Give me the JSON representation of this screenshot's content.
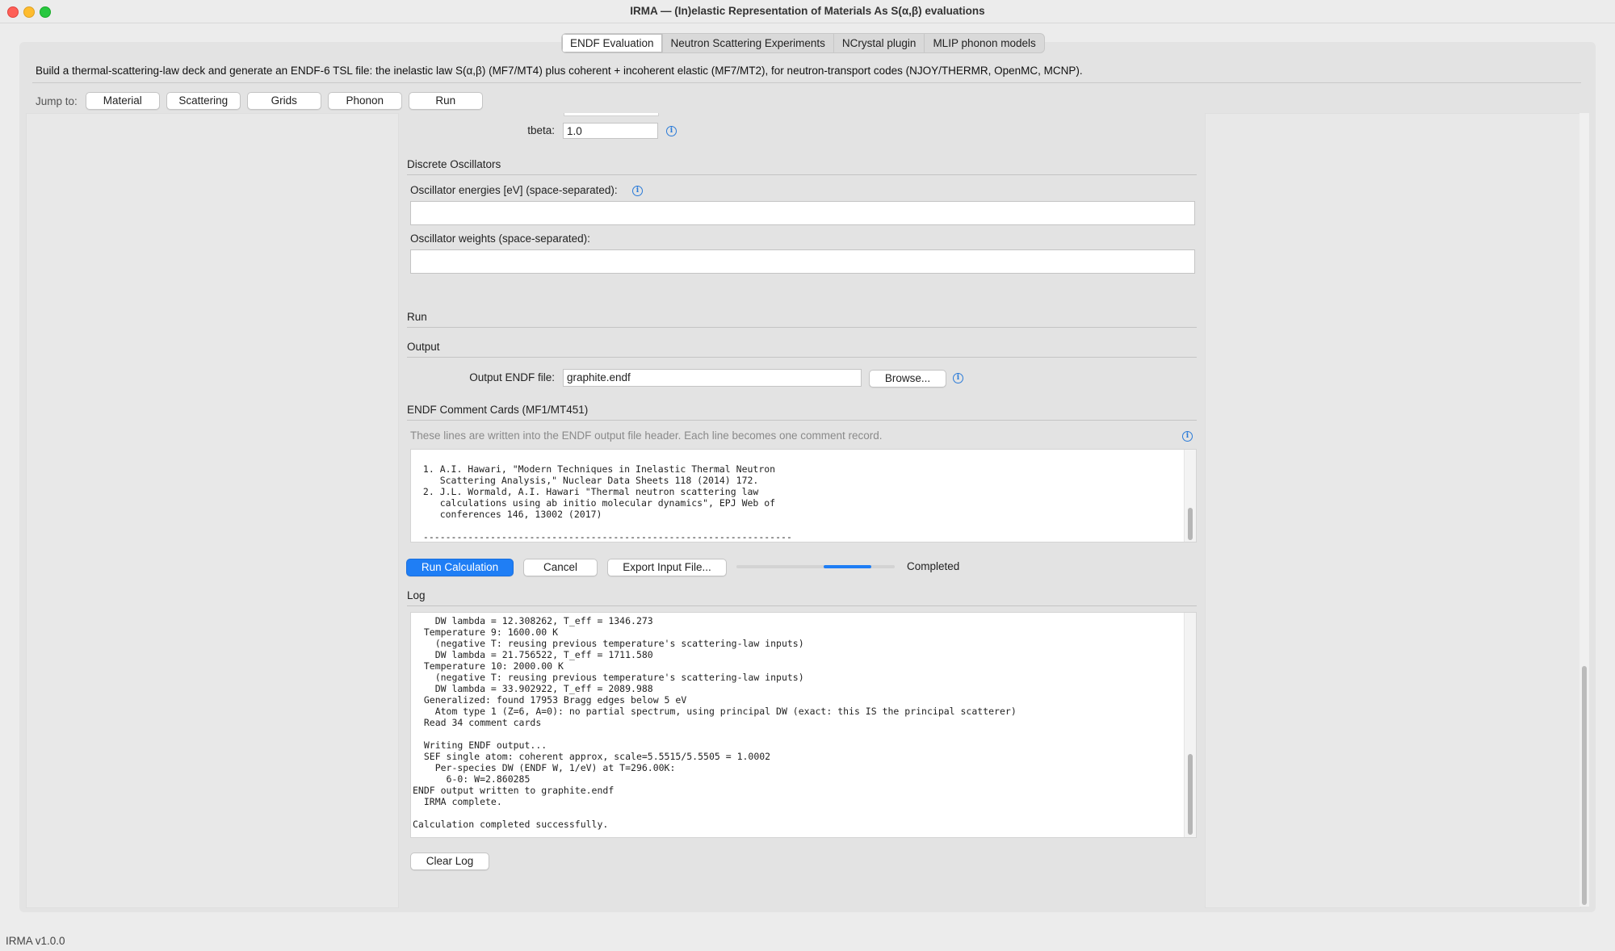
{
  "window": {
    "title": "IRMA — (In)elastic Representation of Materials As S(α,β) evaluations"
  },
  "tabs": [
    {
      "label": "ENDF Evaluation",
      "active": true
    },
    {
      "label": "Neutron Scattering Experiments",
      "active": false
    },
    {
      "label": "NCrystal plugin",
      "active": false
    },
    {
      "label": "MLIP phonon models",
      "active": false
    }
  ],
  "description": "Build a thermal-scattering-law deck and generate an ENDF-6 TSL file: the inelastic law S(α,β) (MF7/MT4) plus coherent + incoherent elastic (MF7/MT2), for neutron-transport codes (NJOY/THERMR, OpenMC, MCNP).",
  "jump": {
    "label": "Jump to:",
    "buttons": [
      "Material",
      "Scattering",
      "Grids",
      "Phonon",
      "Run"
    ]
  },
  "tbeta": {
    "label": "tbeta:",
    "value": "1.0"
  },
  "oscillators": {
    "section": "Discrete Oscillators",
    "energies_label": "Oscillator energies [eV] (space-separated):",
    "energies_value": "",
    "weights_label": "Oscillator weights (space-separated):",
    "weights_value": ""
  },
  "run_section": "Run",
  "output": {
    "section": "Output",
    "file_label": "Output ENDF file:",
    "file_value": "graphite.endf",
    "browse": "Browse..."
  },
  "comments": {
    "section": "ENDF Comment Cards (MF1/MT451)",
    "hint": "These lines are written into the ENDF output file header. Each line becomes one comment record.",
    "text": " 1. A.I. Hawari, \"Modern Techniques in Inelastic Thermal Neutron\n    Scattering Analysis,\" Nuclear Data Sheets 118 (2014) 172.\n 2. J.L. Wormald, A.I. Hawari \"Thermal neutron scattering law\n    calculations using ab initio molecular dynamics\", EPJ Web of\n    conferences 146, 13002 (2017)\n\n ------------------------------------------------------------------"
  },
  "actions": {
    "run": "Run Calculation",
    "cancel": "Cancel",
    "export": "Export Input File...",
    "status": "Completed",
    "progress_fraction": 0.3
  },
  "log": {
    "section": "Log",
    "text": "    DW lambda = 12.308262, T_eff = 1346.273\n  Temperature 9: 1600.00 K\n    (negative T: reusing previous temperature's scattering-law inputs)\n    DW lambda = 21.756522, T_eff = 1711.580\n  Temperature 10: 2000.00 K\n    (negative T: reusing previous temperature's scattering-law inputs)\n    DW lambda = 33.902922, T_eff = 2089.988\n  Generalized: found 17953 Bragg edges below 5 eV\n    Atom type 1 (Z=6, A=0): no partial spectrum, using principal DW (exact: this IS the principal scatterer)\n  Read 34 comment cards\n\n  Writing ENDF output...\n  SEF single atom: coherent approx, scale=5.5515/5.5505 = 1.0002\n    Per-species DW (ENDF W, 1/eV) at T=296.00K:\n      6-0: W=2.860285\nENDF output written to graphite.endf\n  IRMA complete.\n\nCalculation completed successfully.",
    "clear": "Clear Log"
  },
  "statusbar": "IRMA v1.0.0",
  "colors": {
    "accent": "#1f7ef5",
    "info": "#2b7bd8"
  }
}
